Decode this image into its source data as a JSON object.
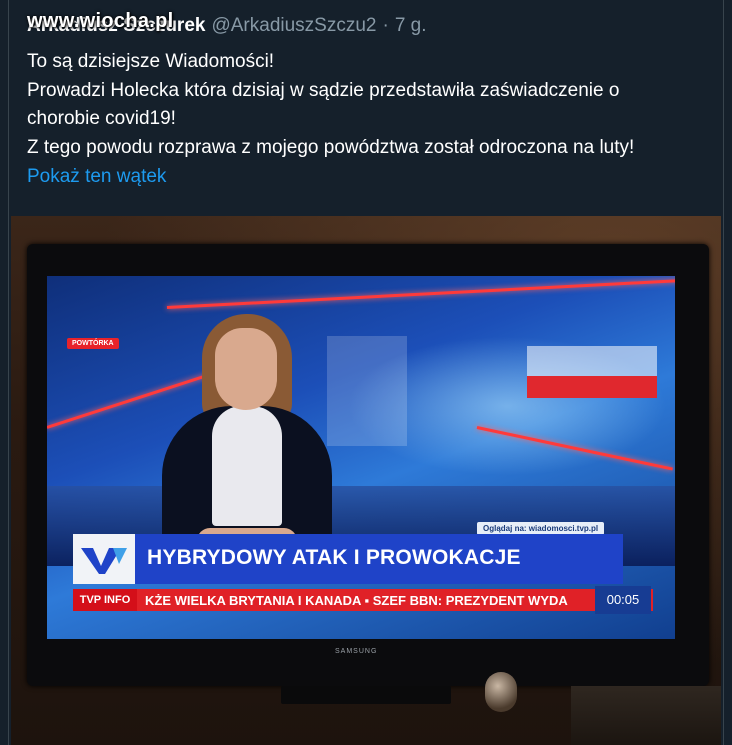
{
  "tweet": {
    "author_name": "Arkadiusz Szczurek",
    "author_handle": "@ArkadiuszSzczu2",
    "separator": "·",
    "time_ago": "7 g.",
    "text_lines": [
      "To  są dzisiejsze Wiadomości!",
      "Prowadzi Holecka która dzisiaj w sądzie przedstawiła zaświadczenie o",
      "chorobie covid19!",
      "Z tego powodu rozprawa z mojego powództwa został odroczona na luty!"
    ],
    "thread_link_label": "Pokaż ten wątek"
  },
  "watermark": "www.wiocha.pl",
  "photo": {
    "repeat_badge": "POWTÓRKA",
    "website_badge": "Oglądaj na: wiadomosci.tvp.pl",
    "headline": "HYBRYDOWY ATAK I PROWOKACJE",
    "ticker_logo": "TVP INFO",
    "ticker_text": "KŻE WIELKA BRYTANIA I KANADA ▪ SZEF BBN: PREZYDENT WYDA",
    "clock": "00:05",
    "tv_brand": "SAMSUNG"
  },
  "colors": {
    "background": "#15202b",
    "link": "#1d9bf0",
    "muted": "#8899a6",
    "ticker_red": "#e02127",
    "headline_blue": "#1f43c8"
  }
}
